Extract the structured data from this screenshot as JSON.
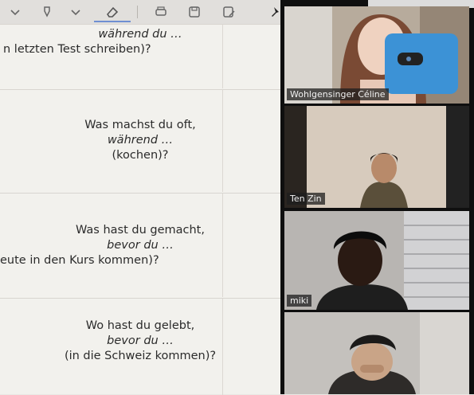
{
  "whiteboard": {
    "toolbar_icons": [
      "chevron-down-icon",
      "brush-icon",
      "chevron-down-icon",
      "eraser-icon",
      "print-icon",
      "save-icon",
      "save-as-icon",
      "pin-icon"
    ],
    "panels": [
      {
        "line1": "während du …",
        "line2": "n letzten Test schreiben)?",
        "line3": ""
      },
      {
        "line1": "Was machst du oft,",
        "line2": "während …",
        "line3": "(kochen)?"
      },
      {
        "line1": "Was hast du gemacht,",
        "line2": "bevor du …",
        "line3": "eute in den Kurs kommen)?"
      },
      {
        "line1": "Wo hast du gelebt,",
        "line2": "bevor du …",
        "line3": "(in die Schweiz kommen)?"
      }
    ]
  },
  "video": {
    "participants": [
      {
        "name": "Wohlgensinger Céline"
      },
      {
        "name": "Ten Zin"
      },
      {
        "name": "miki"
      },
      {
        "name": ""
      }
    ]
  },
  "colors": {
    "active_speaker": "#9acd3a"
  }
}
